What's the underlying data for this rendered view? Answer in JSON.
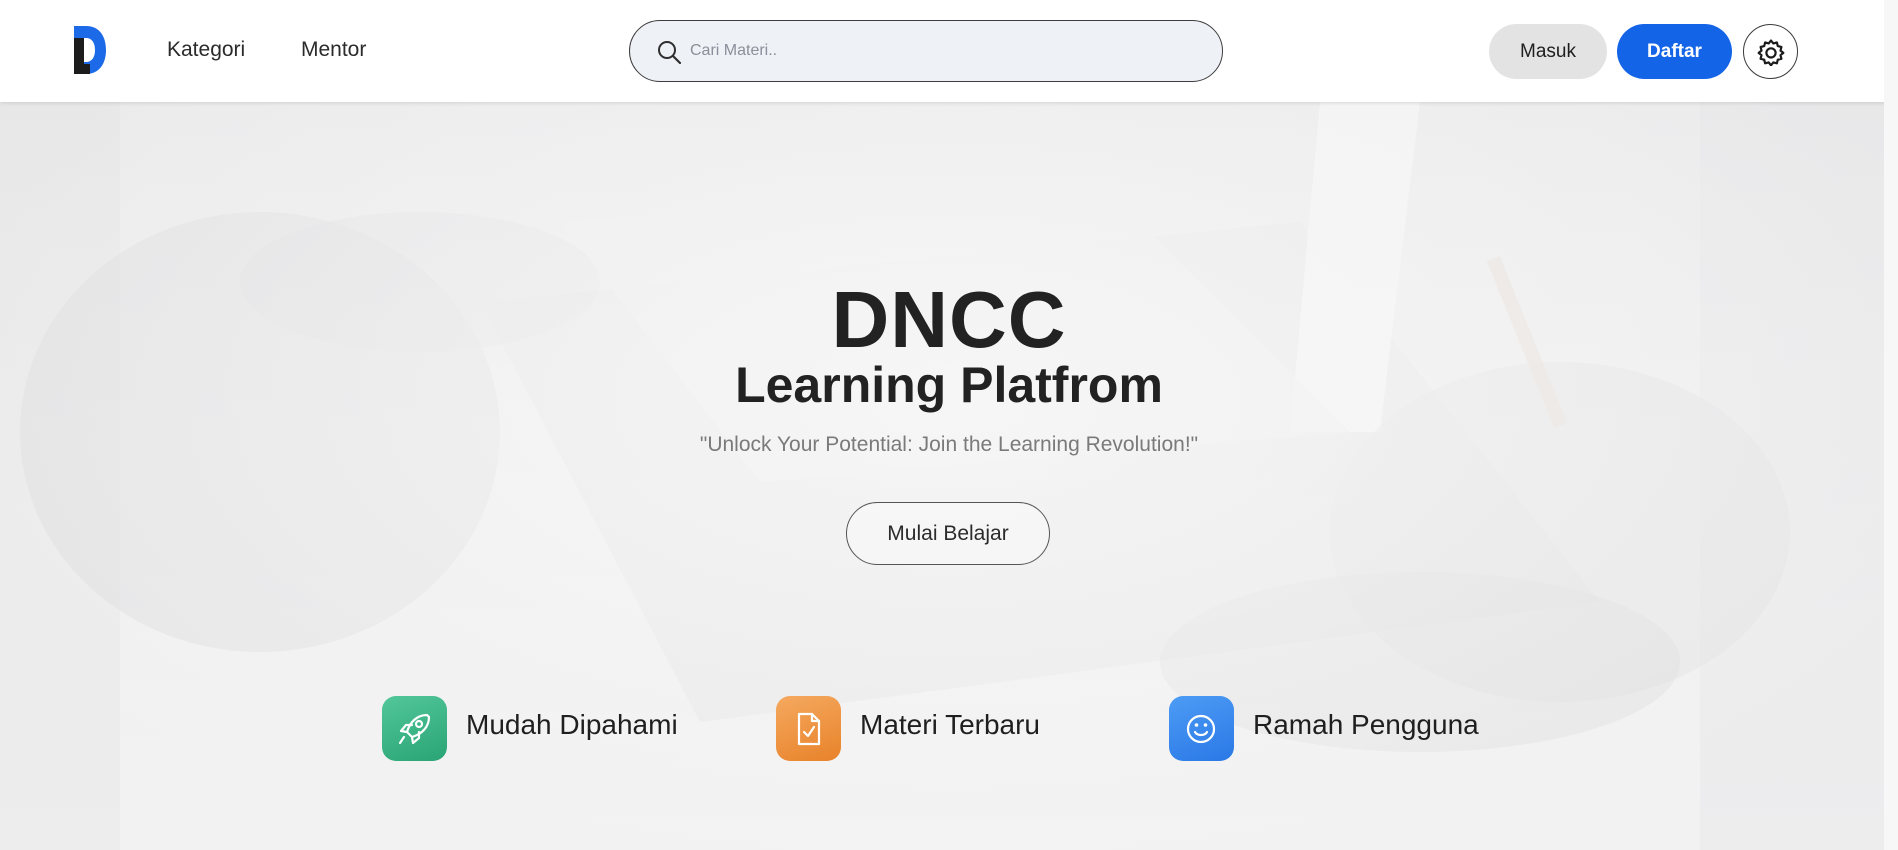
{
  "nav": {
    "logo_icon": "dncc-logo-icon",
    "links": [
      {
        "label": "Kategori"
      },
      {
        "label": "Mentor"
      }
    ],
    "search": {
      "placeholder": "Cari Materi..",
      "value": "",
      "icon": "search-icon"
    },
    "buttons": {
      "login_label": "Masuk",
      "register_label": "Daftar",
      "settings_icon": "gear-icon"
    }
  },
  "hero": {
    "title": "DNCC",
    "subtitle": "Learning Platfrom",
    "tagline": "\"Unlock Your Potential: Join the Learning Revolution!\"",
    "cta_label": "Mulai Belajar"
  },
  "features": [
    {
      "label": "Mudah Dipahami",
      "icon": "rocket-icon",
      "color": "#3bb887"
    },
    {
      "label": "Materi Terbaru",
      "icon": "document-check-icon",
      "color": "#ee9240"
    },
    {
      "label": "Ramah Pengguna",
      "icon": "smiley-icon",
      "color": "#3a88ee"
    }
  ],
  "colors": {
    "primary": "#1464e8",
    "nav_bg": "#ffffff",
    "search_bg": "#eef1f6",
    "secondary_button": "#e3e3e4"
  }
}
